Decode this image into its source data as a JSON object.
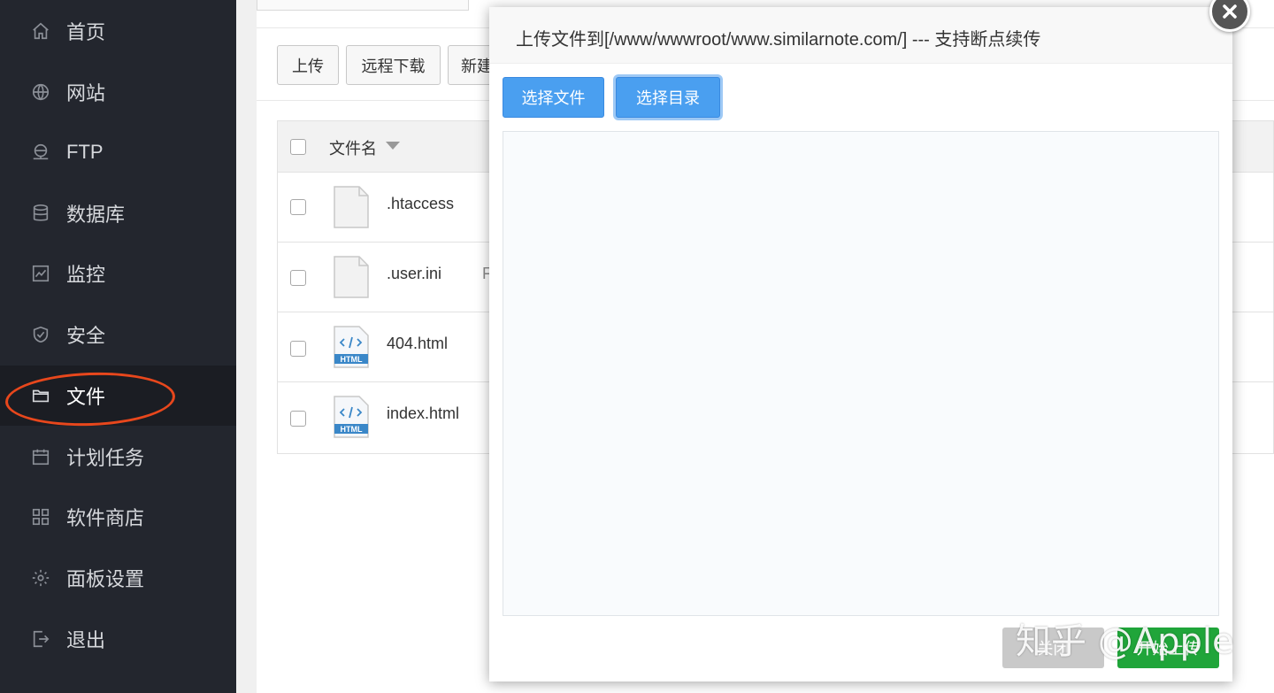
{
  "sidebar": {
    "items": [
      {
        "label": "首页",
        "icon": "home-icon"
      },
      {
        "label": "网站",
        "icon": "globe-icon"
      },
      {
        "label": "FTP",
        "icon": "ftp-icon"
      },
      {
        "label": "数据库",
        "icon": "database-icon"
      },
      {
        "label": "监控",
        "icon": "monitor-icon"
      },
      {
        "label": "安全",
        "icon": "shield-icon"
      },
      {
        "label": "文件",
        "icon": "folder-icon",
        "active": true
      },
      {
        "label": "计划任务",
        "icon": "calendar-icon"
      },
      {
        "label": "软件商店",
        "icon": "grid-icon"
      },
      {
        "label": "面板设置",
        "icon": "gear-icon"
      },
      {
        "label": "退出",
        "icon": "logout-icon"
      }
    ]
  },
  "toolbar": {
    "upload": "上传",
    "remote_download": "远程下载",
    "new": "新建"
  },
  "file_table": {
    "header": "文件名",
    "rows": [
      {
        "name": ".htaccess",
        "type": "file"
      },
      {
        "name": ".user.ini",
        "type": "file",
        "extra": "F"
      },
      {
        "name": "404.html",
        "type": "html"
      },
      {
        "name": "index.html",
        "type": "html"
      }
    ],
    "html_badge": "HTML"
  },
  "modal": {
    "title": "上传文件到[/www/wwwroot/www.similarnote.com/] --- 支持断点续传",
    "select_file": "选择文件",
    "select_dir": "选择目录",
    "close": "关闭",
    "start_upload": "开始上传"
  },
  "watermark": "知乎 @Apple",
  "colors": {
    "sidebar_bg": "#23262e",
    "primary_blue": "#4a9ff0",
    "start_green": "#20a53a",
    "highlight_red": "#e8471c"
  }
}
